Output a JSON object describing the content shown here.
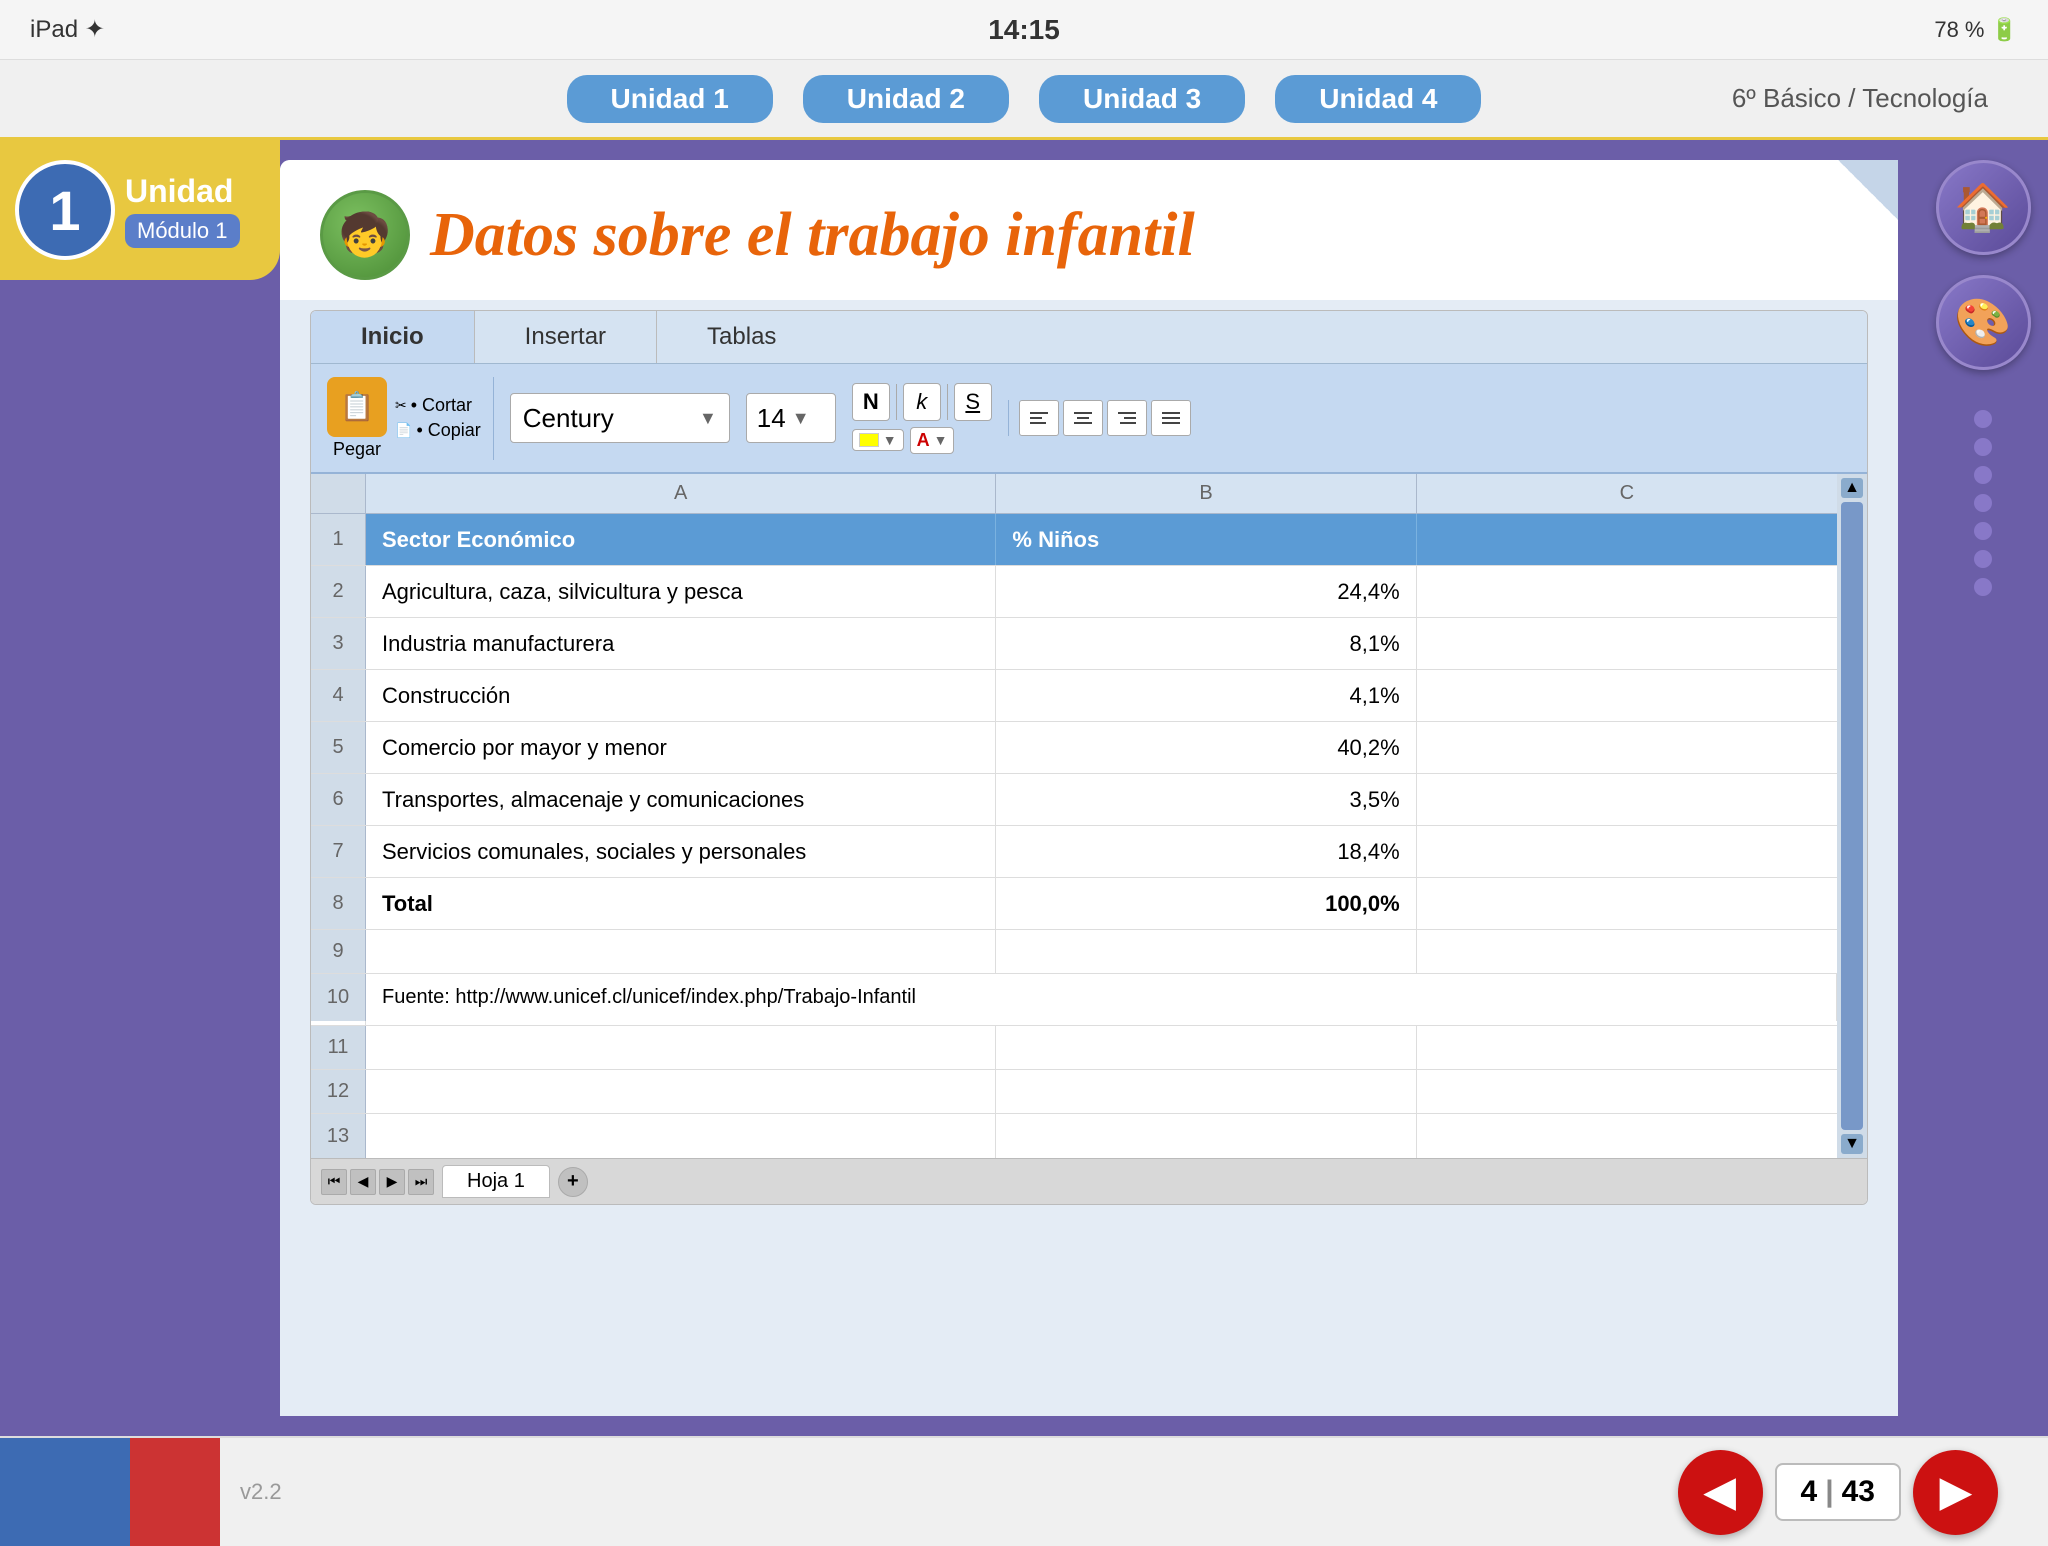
{
  "device": {
    "status_left": "iPad ✦",
    "time": "14:15",
    "battery": "78 % 🔋"
  },
  "nav": {
    "tabs": [
      "Unidad 1",
      "Unidad 2",
      "Unidad 3",
      "Unidad 4"
    ],
    "active_tab": 0,
    "course": "6º Básico / Tecnología"
  },
  "unit": {
    "number": "1",
    "label": "Unidad",
    "module": "Módulo 1"
  },
  "page": {
    "title": "Datos sobre el trabajo infantil",
    "avatar_emoji": "🧒"
  },
  "ribbon": {
    "tabs": [
      "Inicio",
      "Insertar",
      "Tablas"
    ],
    "active_tab": 0,
    "paste_label": "Pegar",
    "cut_label": "• Cortar",
    "copy_label": "• Copiar",
    "font": "Century",
    "font_size": "14",
    "bold": "N",
    "italic": "k",
    "underline": "S"
  },
  "spreadsheet": {
    "col_headers": [
      "",
      "A",
      "B",
      "C",
      ""
    ],
    "rows": [
      {
        "num": "1",
        "cells": [
          "Sector Económico",
          "% Niños",
          "",
          ""
        ],
        "header": true
      },
      {
        "num": "2",
        "cells": [
          "Agricultura, caza, silvicultura y pesca",
          "24,4%",
          "",
          ""
        ],
        "header": false
      },
      {
        "num": "3",
        "cells": [
          "Industria manufacturera",
          "8,1%",
          "",
          ""
        ],
        "header": false
      },
      {
        "num": "4",
        "cells": [
          "Construcción",
          "4,1%",
          "",
          ""
        ],
        "header": false
      },
      {
        "num": "5",
        "cells": [
          "Comercio por mayor y menor",
          "40,2%",
          "",
          ""
        ],
        "header": false
      },
      {
        "num": "6",
        "cells": [
          "Transportes, almacenaje y comunicaciones",
          "3,5%",
          "",
          ""
        ],
        "header": false
      },
      {
        "num": "7",
        "cells": [
          "Servicios comunales, sociales y personales",
          "18,4%",
          "",
          ""
        ],
        "header": false
      },
      {
        "num": "8",
        "cells": [
          "Total",
          "100,0%",
          "",
          ""
        ],
        "header": false,
        "bold": true
      },
      {
        "num": "9",
        "cells": [
          "",
          "",
          "",
          ""
        ],
        "header": false
      },
      {
        "num": "10",
        "cells": [
          "Fuente: http://www.unicef.cl/unicef/index.php/Trabajo-Infantil",
          "",
          "",
          ""
        ],
        "header": false
      },
      {
        "num": "11",
        "cells": [
          "",
          "",
          "",
          ""
        ],
        "header": false
      },
      {
        "num": "12",
        "cells": [
          "",
          "",
          "",
          ""
        ],
        "header": false
      },
      {
        "num": "13",
        "cells": [
          "",
          "",
          "",
          ""
        ],
        "header": false
      }
    ],
    "sheet_tab": "Hoja 1"
  },
  "pagination": {
    "current": "4",
    "total": "43"
  },
  "version": "v2.2"
}
